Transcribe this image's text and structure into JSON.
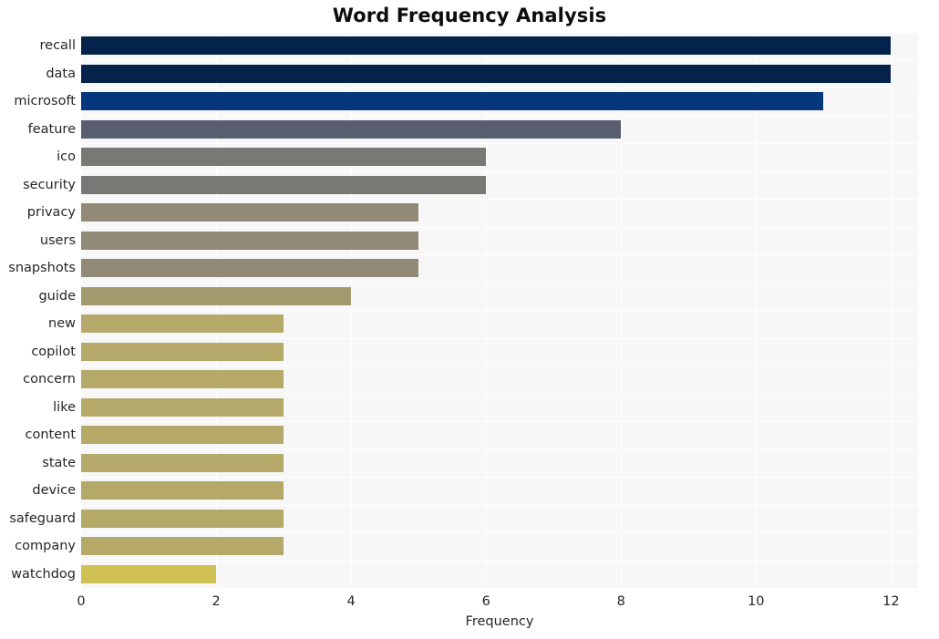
{
  "chart_data": {
    "type": "bar",
    "orientation": "horizontal",
    "title": "Word Frequency Analysis",
    "xlabel": "Frequency",
    "ylabel": "",
    "xlim": [
      0,
      12.4
    ],
    "xticks": [
      "0",
      "2",
      "4",
      "6",
      "8",
      "10",
      "12"
    ],
    "xtick_values": [
      0,
      2,
      4,
      6,
      8,
      10,
      12
    ],
    "grid": true,
    "grid_color": "#ffffff",
    "plot_background": "#f7f7f7",
    "legend": null,
    "categories": [
      "recall",
      "data",
      "microsoft",
      "feature",
      "ico",
      "security",
      "privacy",
      "users",
      "snapshots",
      "guide",
      "new",
      "copilot",
      "concern",
      "like",
      "content",
      "state",
      "device",
      "safeguard",
      "company",
      "watchdog"
    ],
    "values": [
      12,
      12,
      11,
      8,
      6,
      6,
      5,
      5,
      5,
      4,
      3,
      3,
      3,
      3,
      3,
      3,
      3,
      3,
      3,
      2
    ],
    "bar_colors": [
      "#04234b",
      "#04234b",
      "#06377c",
      "#585d70",
      "#787874",
      "#787874",
      "#908a76",
      "#908a76",
      "#908a76",
      "#a39a6d",
      "#b5a96a",
      "#b5a96a",
      "#b5a96a",
      "#b5a96a",
      "#b5a96a",
      "#b5a96a",
      "#b5a96a",
      "#b5a96a",
      "#b5a96a",
      "#d0c054"
    ]
  }
}
